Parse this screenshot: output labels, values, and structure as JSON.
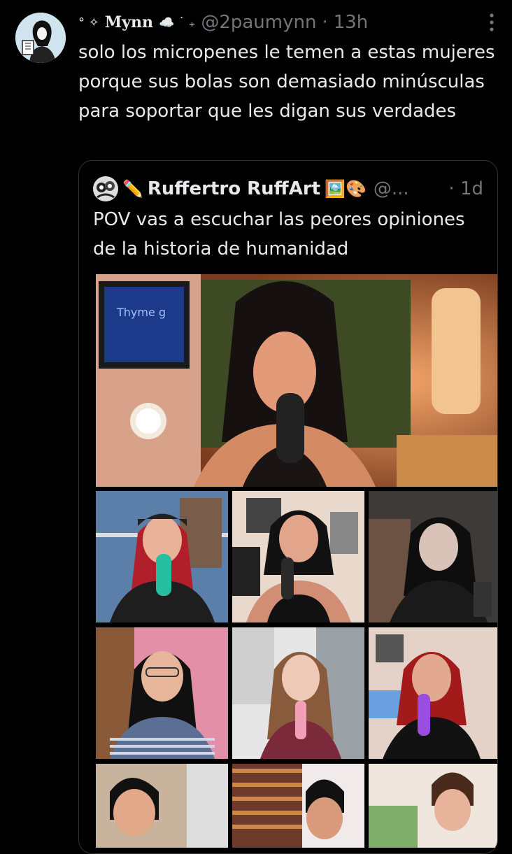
{
  "tweet": {
    "display_name": "Mynn",
    "name_prefix": "° ✧",
    "name_suffix": "☁️ ˙ ₊",
    "handle": "@2paumynn",
    "separator": "·",
    "time": "13h",
    "more_icon": "more-vertical-icon",
    "text": "solo los micropenes le temen a estas mujeres porque sus bolas son demasiado minúsculas para soportar que les digan sus verdades"
  },
  "quote": {
    "name_prefix": "✏️",
    "display_name": "Ruffertro RuffArt",
    "name_suffix": "🖼️🎨",
    "handle": "@...",
    "separator": "·",
    "time": "1d",
    "text": "POV vas a escuchar las peores opiniones de la historia de humanidad",
    "media_sign_text": "Thyme g"
  },
  "colors": {
    "background": "#000000",
    "text": "#e7e9ea",
    "muted": "#71767b",
    "border": "#2f3336"
  }
}
